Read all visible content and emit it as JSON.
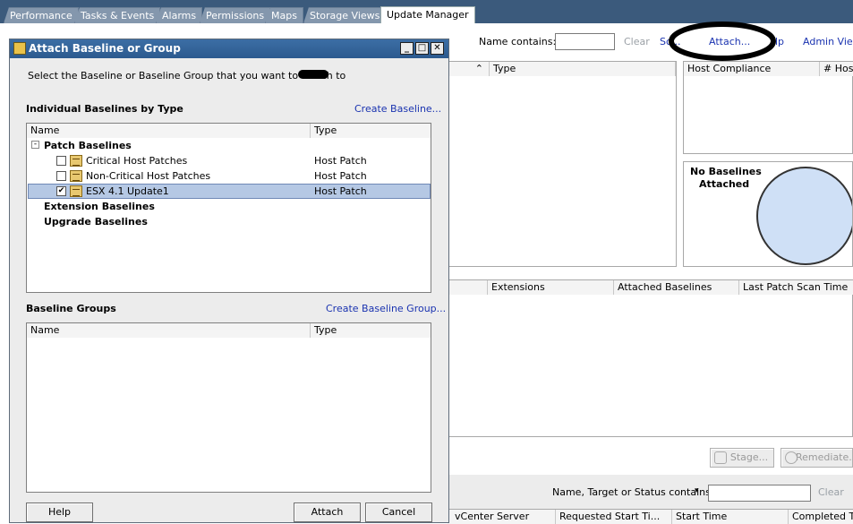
{
  "tabs": [
    "Performance",
    "Tasks & Events",
    "Alarms",
    "Permissions",
    "Maps",
    "Storage Views",
    "Update Manager"
  ],
  "toolbar": {
    "name_contains_label": "Name contains:",
    "clear": "Clear",
    "scan": "Sc...",
    "attach": "Attach...",
    "help_partial": "lp",
    "admin_view": "Admin View"
  },
  "top_table": {
    "type_header": "Type"
  },
  "compliance": {
    "host_compliance": "Host Compliance",
    "hosts": "# Host",
    "no_baselines": "No Baselines",
    "attached": "Attached"
  },
  "mid_table": {
    "headers": [
      "Extensions",
      "Attached Baselines",
      "Last Patch Scan Time"
    ]
  },
  "buttons": {
    "stage": "Stage...",
    "remediate": "Remediate..."
  },
  "filter": {
    "label": "Name, Target or Status contains:",
    "clear": "Clear"
  },
  "tasks_headers": [
    "vCenter Server",
    "Requested Start Ti...",
    "Start Time",
    "Completed Tim"
  ],
  "dialog": {
    "title": "Attach Baseline or Group",
    "instruction": "Select the Baseline or Baseline Group that you want to attach to",
    "individual_heading": "Individual Baselines by Type",
    "create_baseline": "Create Baseline...",
    "col_name": "Name",
    "col_type": "Type",
    "patch_group": "Patch Baselines",
    "patch_items": [
      {
        "name": "Critical Host Patches",
        "type": "Host Patch",
        "checked": false
      },
      {
        "name": "Non-Critical Host Patches",
        "type": "Host Patch",
        "checked": false
      },
      {
        "name": "ESX 4.1 Update1",
        "type": "Host Patch",
        "checked": true
      }
    ],
    "extension_group": "Extension Baselines",
    "upgrade_group": "Upgrade Baselines",
    "groups_heading": "Baseline Groups",
    "create_group": "Create Baseline Group...",
    "help": "Help",
    "attach": "Attach",
    "cancel": "Cancel"
  }
}
